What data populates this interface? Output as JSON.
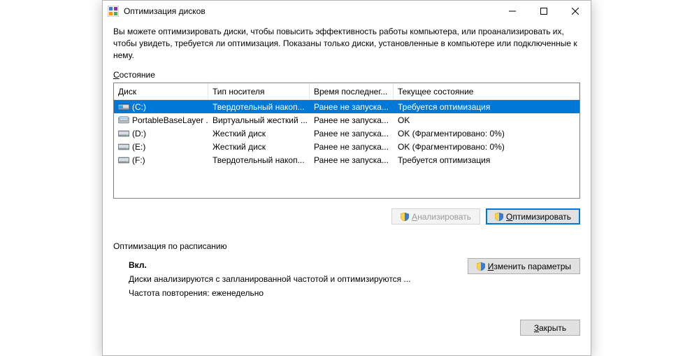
{
  "window": {
    "title": "Оптимизация дисков",
    "description": "Вы можете оптимизировать диски, чтобы повысить эффективность работы  компьютера, или проанализировать их, чтобы увидеть, требуется ли оптимизация. Показаны только диски, установленные в компьютере или подключенные к нему.",
    "state_label_pre": "С",
    "state_label_rest": "остояние"
  },
  "columns": {
    "disk": "Диск",
    "media": "Тип носителя",
    "last": "Время последнег...",
    "state": "Текущее состояние"
  },
  "drives": [
    {
      "icon": "os-drive",
      "name": "(C:)",
      "media": "Твердотельный накоп...",
      "last": "Ранее не запуска...",
      "state": "Требуется оптимизация",
      "selected": true
    },
    {
      "icon": "vhd-drive",
      "name": "PortableBaseLayer ...",
      "media": "Виртуальный жесткий ...",
      "last": "Ранее не запуска...",
      "state": "OK",
      "selected": false
    },
    {
      "icon": "hdd-drive",
      "name": "(D:)",
      "media": "Жесткий диск",
      "last": "Ранее не запуска...",
      "state": "OK (Фрагментировано: 0%)",
      "selected": false
    },
    {
      "icon": "hdd-drive",
      "name": "(E:)",
      "media": "Жесткий диск",
      "last": "Ранее не запуска...",
      "state": "OK (Фрагментировано: 0%)",
      "selected": false
    },
    {
      "icon": "hdd-drive",
      "name": "(F:)",
      "media": "Твердотельный накоп...",
      "last": "Ранее не запуска...",
      "state": "Требуется оптимизация",
      "selected": false
    }
  ],
  "buttons": {
    "analyze_pre": "А",
    "analyze_rest": "нализировать",
    "optimize_pre": "О",
    "optimize_rest": "птимизировать",
    "change_pre": "И",
    "change_rest": "зменить параметры",
    "close_pre": "З",
    "close_rest": "акрыть"
  },
  "schedule": {
    "group_label": "Оптимизация по расписанию",
    "on_label": "Вкл.",
    "line1": "Диски анализируются с запланированной частотой и оптимизируются ...",
    "line2": "Частота повторения: еженедельно"
  },
  "icons": {
    "app": "defrag-icon",
    "minimize": "minimize-icon",
    "maximize": "maximize-icon",
    "close": "close-icon",
    "shield": "shield-icon"
  }
}
